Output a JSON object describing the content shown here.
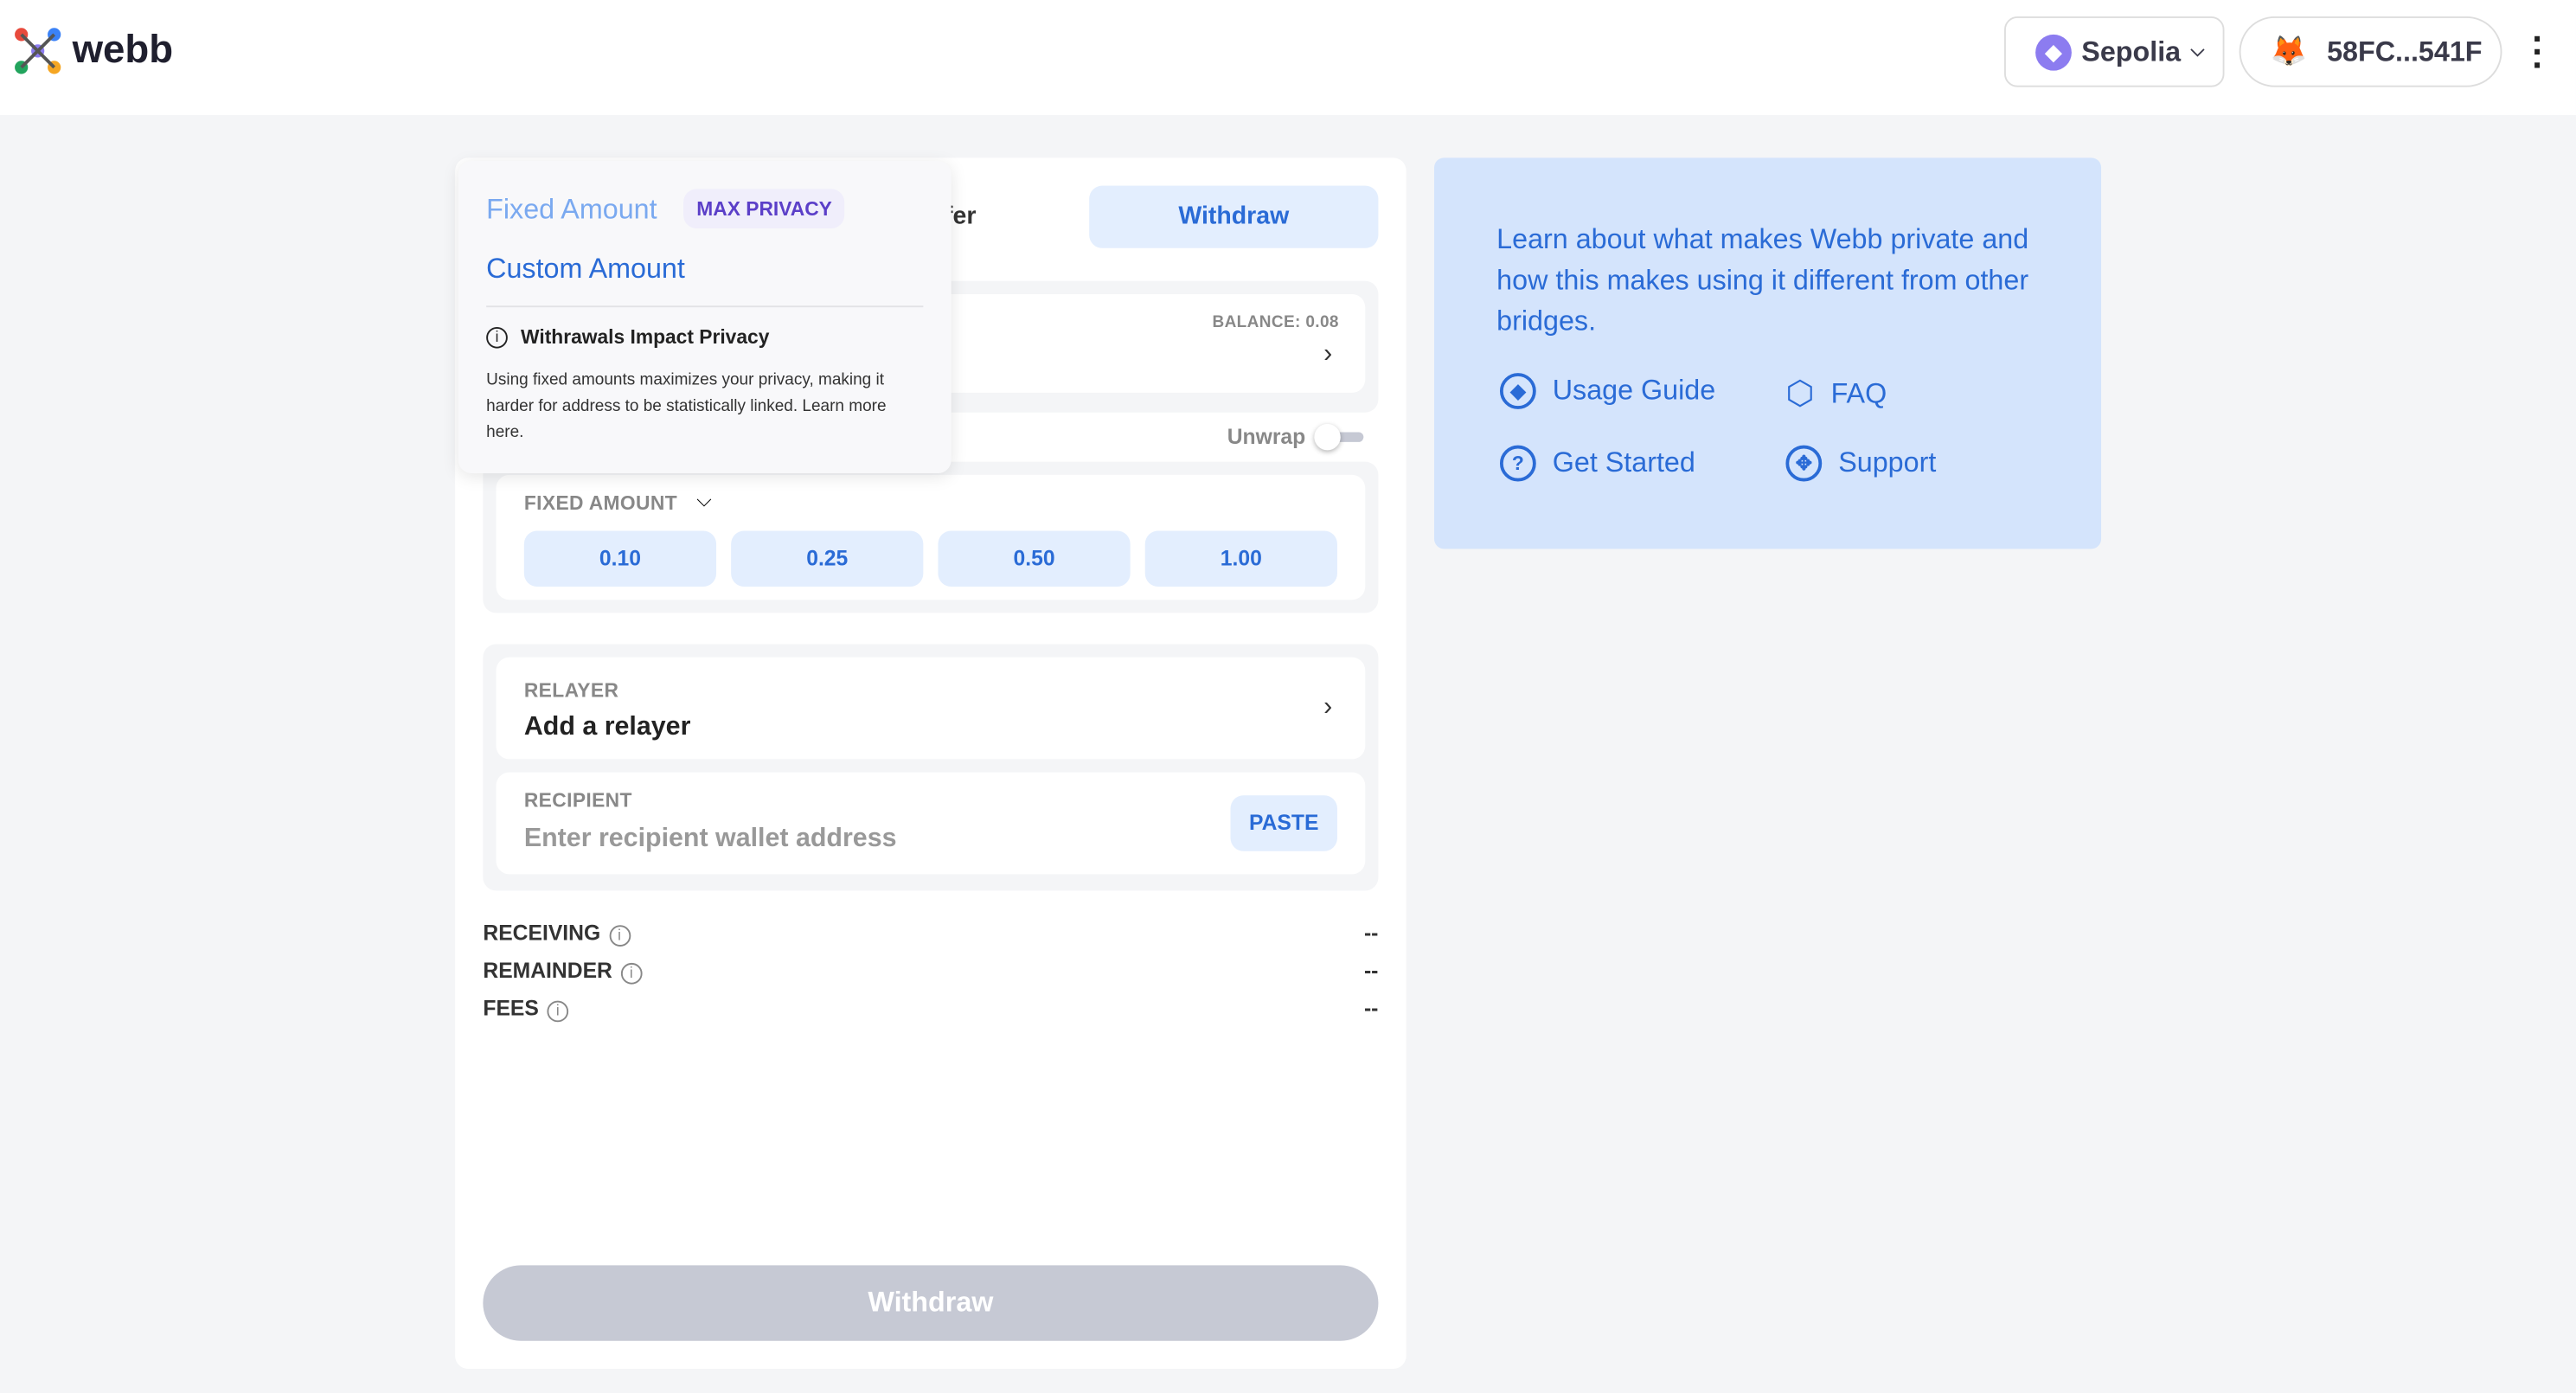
{
  "header": {
    "brand": "webb",
    "network": "Sepolia",
    "wallet": "58FC...541F"
  },
  "tabs": {
    "transfer_partial": "fer",
    "withdraw": "Withdraw"
  },
  "token": {
    "balance": "BALANCE: 0.08"
  },
  "unwrap": {
    "label": "Unwrap",
    "on": false
  },
  "fixed": {
    "label": "FIXED AMOUNT",
    "amounts": [
      "0.10",
      "0.25",
      "0.50",
      "1.00"
    ]
  },
  "relayer": {
    "label": "RELAYER",
    "value": "Add a relayer"
  },
  "recipient": {
    "label": "RECIPIENT",
    "placeholder": "Enter recipient wallet address",
    "paste": "PASTE"
  },
  "summary": [
    {
      "label": "RECEIVING",
      "value": "--"
    },
    {
      "label": "REMAINDER",
      "value": "--"
    },
    {
      "label": "FEES",
      "value": "--"
    }
  ],
  "submit": "Withdraw",
  "popover": {
    "fixed": "Fixed Amount",
    "badge": "MAX PRIVACY",
    "custom": "Custom Amount",
    "title": "Withrawals Impact Privacy",
    "body": "Using fixed amounts maximizes your privacy, making it harder for address to be statistically linked. Learn more here."
  },
  "info": {
    "text": "Learn about what makes Webb private and how this makes using it different from other bridges.",
    "links": [
      "Usage Guide",
      "FAQ",
      "Get Started",
      "Support"
    ]
  }
}
